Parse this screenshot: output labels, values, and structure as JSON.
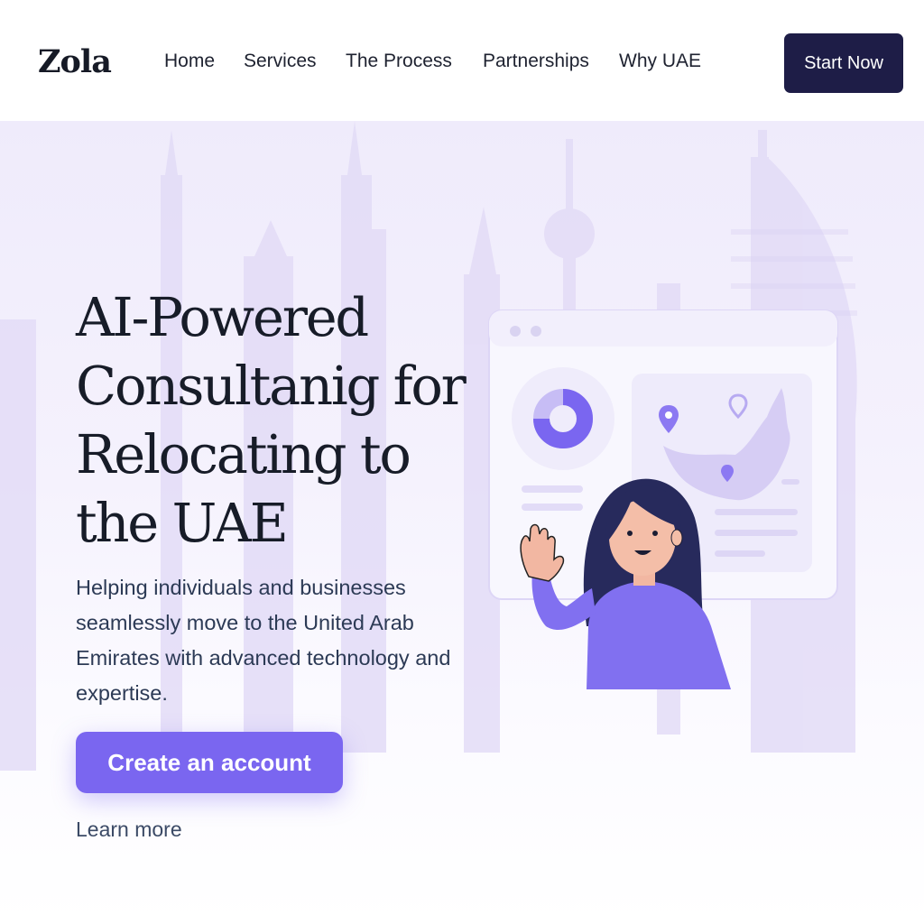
{
  "brand": {
    "logo_text": "Zola"
  },
  "nav": {
    "items": [
      {
        "label": "Home"
      },
      {
        "label": "Services"
      },
      {
        "label": "The Process"
      },
      {
        "label": "Partnerships"
      },
      {
        "label": "Why UAE"
      }
    ],
    "cta_label": "Start Now"
  },
  "hero": {
    "headline_lines": [
      "AI-Powered",
      "Consultanig for",
      "Relocating to",
      "the UAE"
    ],
    "subtext": "Helping individuals and businesses seamlessly move to the United Arab Emirates with advanced technology and expertise.",
    "primary_cta": "Create an account",
    "secondary_link": "Learn more"
  },
  "colors": {
    "accent": "#7a66f0",
    "dark_button": "#1e1d47",
    "hero_background": "#efebfb",
    "text_dark": "#171c28"
  },
  "icons": [
    "browser-window-dots",
    "donut-chart-icon",
    "map-pin-icon",
    "uae-map-icon",
    "waving-woman-illustration"
  ]
}
